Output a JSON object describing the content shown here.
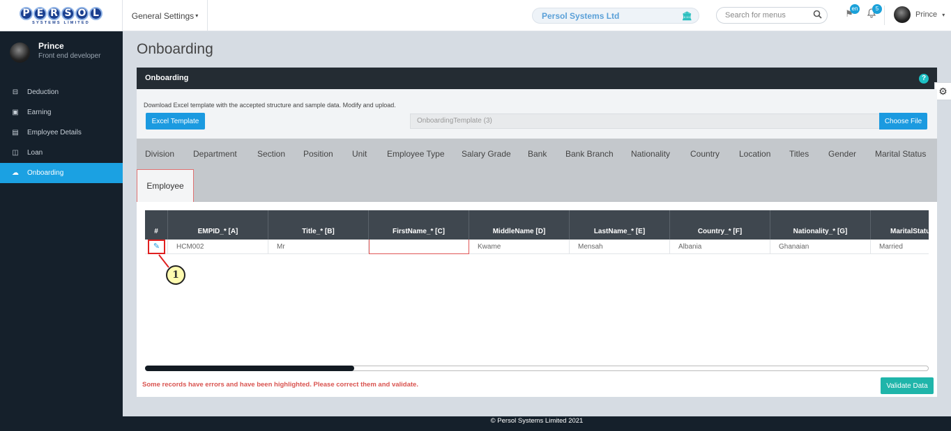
{
  "logo": {
    "letters": [
      "P",
      "E",
      "R",
      "S",
      "O",
      "L"
    ],
    "sub": "SYSTEMS LIMITED"
  },
  "header": {
    "settings_menu": "General Settings",
    "company": "Persol Systems Ltd",
    "search_placeholder": "Search for menus",
    "lang_badge": "en",
    "notif_count": "5",
    "user": "Prince"
  },
  "profile": {
    "name": "Prince",
    "role": "Front end developer"
  },
  "nav": [
    {
      "label": "Deduction",
      "icon": "minus-square-icon"
    },
    {
      "label": "Earning",
      "icon": "money-icon"
    },
    {
      "label": "Employee Details",
      "icon": "id-card-icon"
    },
    {
      "label": "Loan",
      "icon": "cash-icon"
    },
    {
      "label": "Onboarding",
      "icon": "cloud-upload-icon"
    }
  ],
  "page": {
    "title": "Onboarding",
    "panel_title": "Onboarding"
  },
  "upload": {
    "note": "Download Excel template with the accepted structure and sample data. Modify and upload.",
    "template_btn": "Excel Template",
    "file_name": "OnboardingTemplate (3)",
    "choose_btn": "Choose File"
  },
  "tabs": [
    "Division",
    "Department",
    "Section",
    "Position",
    "Unit",
    "Employee Type",
    "Salary Grade",
    "Bank",
    "Bank Branch",
    "Nationality",
    "Country",
    "Location",
    "Titles",
    "Gender",
    "Marital Status"
  ],
  "active_tab": "Employee",
  "table": {
    "headers": [
      "#",
      "EMPID_* [A]",
      "Title_* [B]",
      "FirstName_* [C]",
      "MiddleName [D]",
      "LastName_* [E]",
      "Country_* [F]",
      "Nationality_* [G]",
      "MaritalStatus"
    ],
    "row": [
      "HCM002",
      "Mr",
      "",
      "Kwame",
      "Mensah",
      "Albania",
      "Ghanaian",
      "Married"
    ]
  },
  "callout": "1",
  "error_message": "Some records have errors and have been highlighted. Please correct them and validate.",
  "validate_btn": "Validate Data",
  "footer": "© Persol Systems Limited 2021"
}
